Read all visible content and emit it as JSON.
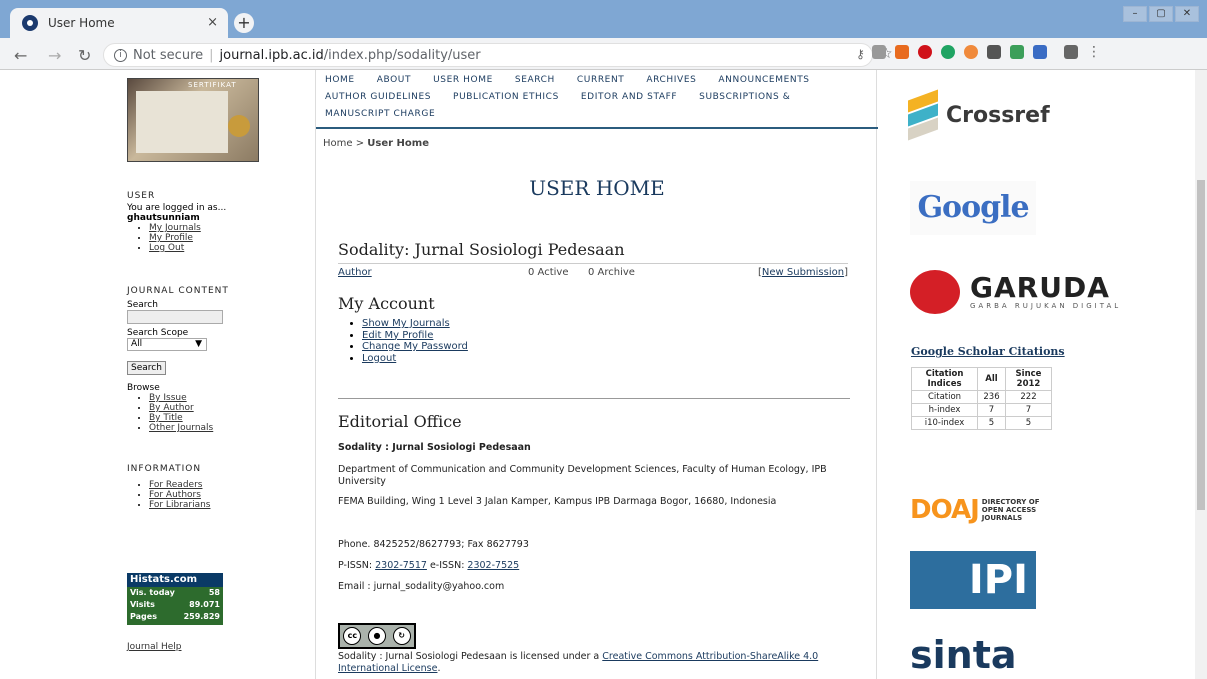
{
  "browser": {
    "tab_title": "User Home",
    "tab_close": "×",
    "new_tab": "+",
    "not_secure": "Not secure",
    "url_host": "journal.ipb.ac.id",
    "url_path": "/index.php/sodality/user",
    "info": "i"
  },
  "nav": {
    "items": [
      "HOME",
      "ABOUT",
      "USER HOME",
      "SEARCH",
      "CURRENT",
      "ARCHIVES",
      "ANNOUNCEMENTS",
      "AUTHOR GUIDELINES",
      "PUBLICATION ETHICS",
      "EDITOR AND STAFF",
      "SUBSCRIPTIONS &",
      "MANUSCRIPT CHARGE"
    ]
  },
  "breadcrumb": {
    "home": "Home",
    "sep": " > ",
    "current": "User Home"
  },
  "sidebar": {
    "cert_title": "SERTIFIKAT",
    "user_heading": "USER",
    "logged_in": "You are logged in as...",
    "username": "ghautsunniam",
    "user_links": [
      "My Journals",
      "My Profile",
      "Log Out"
    ],
    "journal_content": "JOURNAL CONTENT",
    "search_label": "Search",
    "search_scope": "Search Scope",
    "scope_value": "All",
    "search_btn": "Search",
    "browse": "Browse",
    "browse_links": [
      "By Issue",
      "By Author",
      "By Title",
      "Other Journals"
    ],
    "information": "INFORMATION",
    "info_links": [
      "For Readers",
      "For Authors",
      "For Librarians"
    ],
    "histats": {
      "title": "Histats.com",
      "rows": [
        [
          "Vis. today",
          "58"
        ],
        [
          "Visits",
          "89.071"
        ],
        [
          "Pages",
          "259.829"
        ]
      ]
    },
    "journal_help": "Journal Help"
  },
  "main": {
    "title": "USER HOME",
    "journal_name": "Sodality: Jurnal Sosiologi Pedesaan",
    "author_label": "Author",
    "active": "0 Active",
    "archive": "0 Archive",
    "new_submission": "New Submission",
    "my_account": "My Account",
    "account_links": [
      "Show My Journals",
      "Edit My Profile",
      "Change My Password",
      "Logout"
    ],
    "editorial": "Editorial Office",
    "editorial_name": "Sodality : Jurnal Sosiologi Pedesaan",
    "dept": "Department of Communication and Community Development Sciences, Faculty of Human Ecology, IPB University",
    "address": "FEMA Building, Wing 1 Level 3 Jalan Kamper, Kampus IPB Darmaga Bogor, 16680, Indonesia",
    "phone": "Phone. 8425252/8627793; Fax 8627793",
    "pissn_label": "P-ISSN: ",
    "pissn": "2302-7517",
    "eissn_label": " e-ISSN: ",
    "eissn": "2302-7525",
    "email": "Email : jurnal_sodality@yahoo.com",
    "license_pre": "Sodality : Jurnal Sosiologi Pedesaan is licensed under a ",
    "license_link": "Creative Commons Attribution-ShareAlike 4.0 International License",
    "license_post": "."
  },
  "right": {
    "crossref": "Crossref",
    "google": "Google",
    "garuda": "GARUDA",
    "garuda_sub": "GARBA RUJUKAN DIGITAL",
    "gsc_title": "Google Scholar Citations",
    "cit_headers": [
      "Citation Indices",
      "All",
      "Since 2012"
    ],
    "cit_rows": [
      [
        "Citation",
        "236",
        "222"
      ],
      [
        "h-index",
        "7",
        "7"
      ],
      [
        "i10-index",
        "5",
        "5"
      ]
    ],
    "doaj": "DOAJ",
    "doaj_sub": [
      "DIRECTORY OF",
      "OPEN ACCESS",
      "JOURNALS"
    ],
    "ipi": "IPI",
    "sinta": "sinta"
  },
  "colors": {
    "accent": "#1a3a5e",
    "tabbar": "#7fa7d3"
  }
}
